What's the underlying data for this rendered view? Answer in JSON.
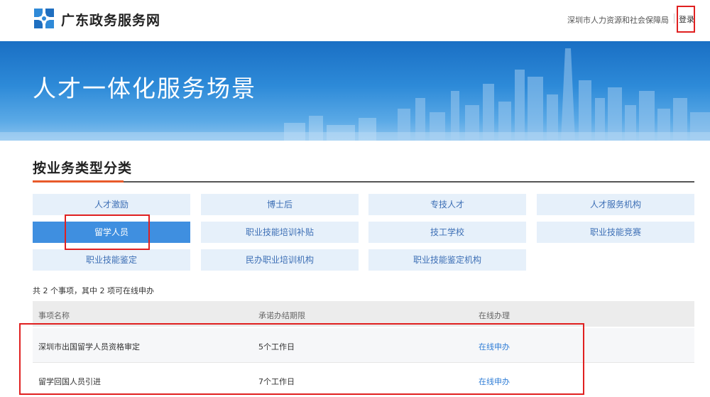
{
  "header": {
    "site_title": "广东政务服务网",
    "department": "深圳市人力资源和社会保障局",
    "login_label": "登录"
  },
  "banner": {
    "title": "人才一体化服务场景"
  },
  "section": {
    "title": "按业务类型分类"
  },
  "categories": [
    {
      "label": "人才激励",
      "active": false
    },
    {
      "label": "博士后",
      "active": false
    },
    {
      "label": "专技人才",
      "active": false
    },
    {
      "label": "人才服务机构",
      "active": false
    },
    {
      "label": "留学人员",
      "active": true
    },
    {
      "label": "职业技能培训补贴",
      "active": false
    },
    {
      "label": "技工学校",
      "active": false
    },
    {
      "label": "职业技能竞赛",
      "active": false
    },
    {
      "label": "职业技能鉴定",
      "active": false
    },
    {
      "label": "民办职业培训机构",
      "active": false
    },
    {
      "label": "职业技能鉴定机构",
      "active": false
    }
  ],
  "summary": "共 2 个事项，其中 2 项可在线申办",
  "table": {
    "headers": [
      "事项名称",
      "承诺办结期限",
      "在线办理"
    ],
    "rows": [
      {
        "name": "深圳市出国留学人员资格审定",
        "deadline": "5个工作日",
        "action": "在线申办"
      },
      {
        "name": "留学回国人员引进",
        "deadline": "7个工作日",
        "action": "在线申办"
      }
    ]
  },
  "colors": {
    "accent": "#3f8fe0",
    "category_bg": "#e6f0fa",
    "highlight": "#e02020",
    "link": "#2f7dd6"
  }
}
